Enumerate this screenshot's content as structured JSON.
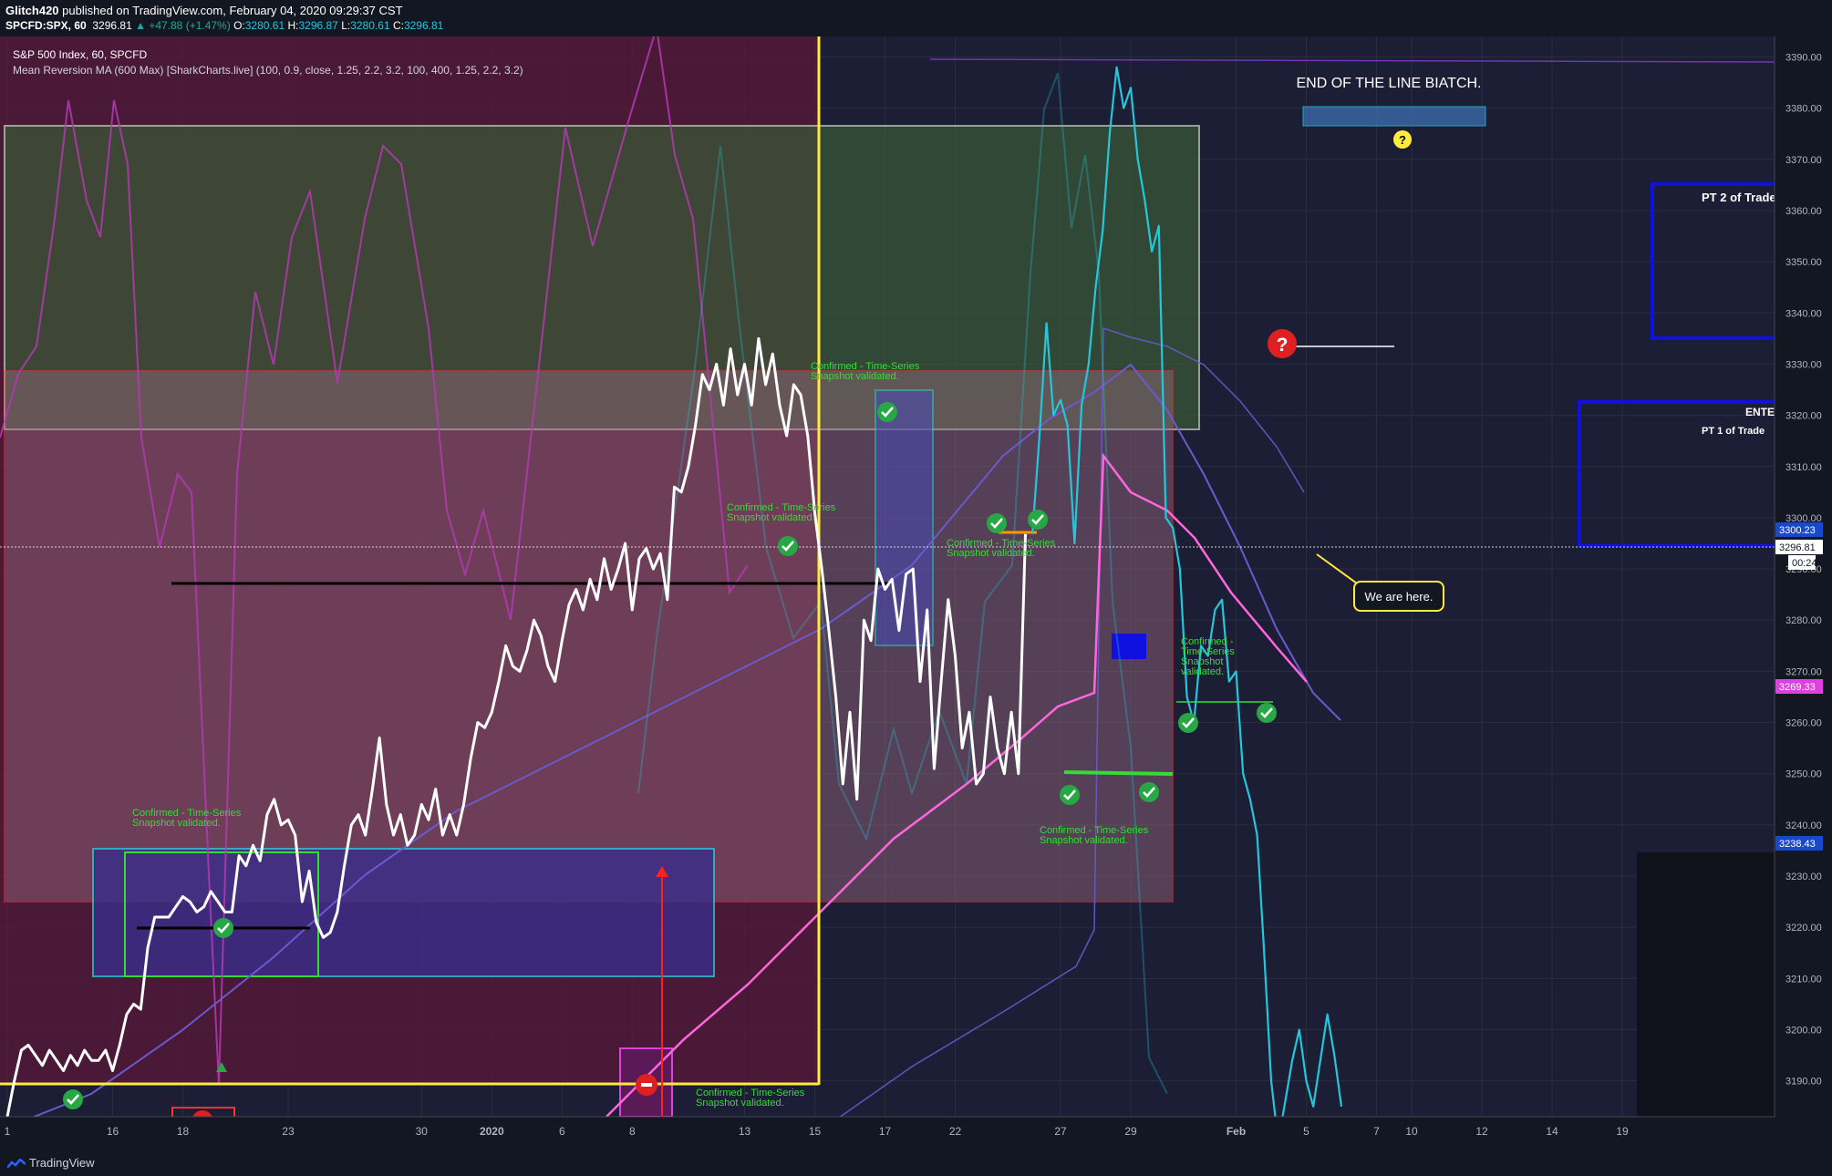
{
  "header": {
    "author": "Glitch420",
    "published_text": " published on TradingView.com, February 04, 2020 09:29:37 CST",
    "symbol": "SPCFD:SPX, 60",
    "last": "3296.81",
    "change": "▲ +47.88 (+1.47%)",
    "o_label": "O:",
    "o_value": "3280.61",
    "h_label": "H:",
    "h_value": "3296.87",
    "l_label": "L:",
    "l_value": "3280.61",
    "c_label": "C:",
    "c_value": "3296.81"
  },
  "legend": {
    "line1": "S&P 500 Index, 60, SPCFD",
    "line2": "Mean Reversion MA (600 Max) [SharkCharts.live] (100, 0.9, close, 1.25, 2.2, 3.2, 100, 400, 1.25, 2.2, 3.2)"
  },
  "footer": {
    "brand": "TradingView"
  },
  "colors": {
    "background": "#131722",
    "price_line": "#ffffff",
    "projection_line": "#26c6da",
    "magenta_ma": "#ff66dd",
    "slow_ma": "#6a5acd",
    "purple_band": "#b33ab3",
    "yellow_line": "#ffeb3b",
    "annotation_green": "#33dd33",
    "blue_box": "#1010e0",
    "price_tag_current": "#1848cc",
    "price_tag_magenta": "#e040e0"
  },
  "annotations": {
    "title_text": "END OF THE LINE BIATCH.",
    "callout_text": "We are here.",
    "pt2_label": "PT 2 of Trade",
    "entered_label": "ENTERED @",
    "pt1_label": "PT 1 of Trade",
    "confirmed_line1": "Confirmed - Time-Series",
    "confirmed_line2": "Snapshot validated.",
    "confirmed_split_a": "Confirmed -",
    "confirmed_split_b": "Time-Series",
    "confirmed_split_c": "Snapshot",
    "confirmed_split_d": "validated."
  },
  "price_tags": {
    "tag_3300": "3300.23",
    "tag_last": "3296.81",
    "tag_countdown": "00:24",
    "tag_3269": "3269.33",
    "tag_3238": "3238.43"
  },
  "chart_data": {
    "type": "line",
    "title": "S&P 500 Index, 60, SPCFD",
    "xlabel": "",
    "ylabel": "",
    "grid": true,
    "ylim": [
      3183,
      3394
    ],
    "y_ticks": [
      3190,
      3200,
      3210,
      3220,
      3230,
      3240,
      3250,
      3260,
      3270,
      3280,
      3290,
      3300,
      3310,
      3320,
      3330,
      3340,
      3350,
      3360,
      3370,
      3380,
      3390
    ],
    "x_tick_labels": [
      "1",
      "16",
      "18",
      "23",
      "30",
      "2020",
      "6",
      "8",
      "13",
      "15",
      "17",
      "22",
      "27",
      "29",
      "Feb",
      "5",
      "7",
      "10",
      "12",
      "14",
      "19"
    ],
    "x_index_range": [
      0,
      250
    ],
    "x_tick_positions": [
      0,
      15,
      25,
      40,
      59,
      69,
      79,
      89,
      105,
      115,
      125,
      135,
      150,
      160,
      175,
      185,
      195,
      200,
      210,
      220,
      230
    ],
    "series": [
      {
        "values": [
          3183,
          3190,
          3196,
          3197,
          3195,
          3193,
          3196,
          3194,
          3192,
          3195,
          3193,
          3196,
          3194,
          3194,
          3196,
          3192,
          3197,
          3203,
          3205,
          3204,
          3216,
          3222,
          3222,
          3222,
          3224,
          3226,
          3225,
          3223,
          3224,
          3227,
          3225,
          3223,
          3223,
          3234,
          3232,
          3236,
          3233,
          3242,
          3245,
          3240,
          3241,
          3238,
          3225,
          3231,
          3221,
          3218,
          3219,
          3223,
          3232,
          3240,
          3242,
          3238,
          3247,
          3257,
          3244,
          3238,
          3242,
          3236,
          3238,
          3244,
          3241,
          3247,
          3238,
          3242,
          3238,
          3244,
          3253,
          3260,
          3259,
          3262,
          3268,
          3275,
          3271,
          3270,
          3274,
          3280,
          3277,
          3271,
          3268,
          3276,
          3283,
          3286,
          3282,
          3288,
          3284,
          3292,
          3286,
          3290,
          3295,
          3282,
          3292,
          3294,
          3290,
          3293,
          3284,
          3306,
          3305,
          3310,
          3318,
          3328,
          3325,
          3330,
          3322,
          3333,
          3324,
          3330,
          3322,
          3335,
          3326,
          3332,
          3322,
          3316,
          3326,
          3324,
          3316,
          3301,
          3290,
          3278,
          3265,
          3248,
          3262,
          3245,
          3280,
          3276,
          3290,
          3286,
          3288,
          3278,
          3289,
          3290,
          3268,
          3282,
          3251,
          3268,
          3284,
          3273,
          3255,
          3262,
          3248,
          3250,
          3265,
          3255,
          3250,
          3262,
          3250,
          3296.81
        ],
        "x_index": [
          0,
          1,
          2,
          3,
          4,
          5,
          6,
          7,
          8,
          9,
          10,
          11,
          12,
          13,
          14,
          15,
          16,
          17,
          18,
          19,
          20,
          21,
          22,
          23,
          24,
          25,
          26,
          27,
          28,
          29,
          30,
          31,
          32,
          33,
          34,
          35,
          36,
          37,
          38,
          39,
          40,
          41,
          42,
          43,
          44,
          45,
          46,
          47,
          48,
          49,
          50,
          51,
          52,
          53,
          54,
          55,
          56,
          57,
          58,
          59,
          60,
          61,
          62,
          63,
          64,
          65,
          66,
          67,
          68,
          69,
          70,
          71,
          72,
          73,
          74,
          75,
          76,
          77,
          78,
          79,
          80,
          81,
          82,
          83,
          84,
          85,
          86,
          87,
          88,
          89,
          90,
          91,
          92,
          93,
          94,
          95,
          96,
          97,
          98,
          99,
          100,
          101,
          102,
          103,
          104,
          105,
          106,
          107,
          108,
          109,
          110,
          111,
          112,
          113,
          114,
          115,
          116,
          117,
          118,
          119,
          120,
          121,
          122,
          123,
          124,
          125,
          126,
          127,
          128,
          129,
          130,
          131,
          132,
          133,
          134,
          135,
          136,
          137,
          138,
          139,
          140,
          141,
          142,
          143,
          144,
          145,
          146
        ]
      },
      {
        "values": [
          3296.81,
          3316,
          3338,
          3320,
          3323,
          3318,
          3295,
          3322,
          3330,
          3345,
          3356,
          3375,
          3388,
          3380,
          3384,
          3370,
          3362,
          3352,
          3357,
          3300,
          3298,
          3290,
          3265,
          3260,
          3275,
          3273,
          3282,
          3284,
          3268,
          3270,
          3250,
          3245,
          3238,
          3215,
          3190,
          3178,
          3186,
          3194,
          3200,
          3190,
          3185,
          3194,
          3203,
          3195,
          3185
        ],
        "x_index": [
          146,
          147,
          148,
          149,
          150,
          151,
          152,
          153,
          154,
          155,
          156,
          157,
          158,
          159,
          160,
          161,
          162,
          163,
          164,
          165,
          166,
          167,
          168,
          169,
          170,
          171,
          172,
          173,
          174,
          175,
          176,
          177,
          178,
          179,
          180,
          181,
          182,
          183,
          184,
          185,
          186,
          187,
          188,
          189,
          190
        ]
      }
    ]
  }
}
